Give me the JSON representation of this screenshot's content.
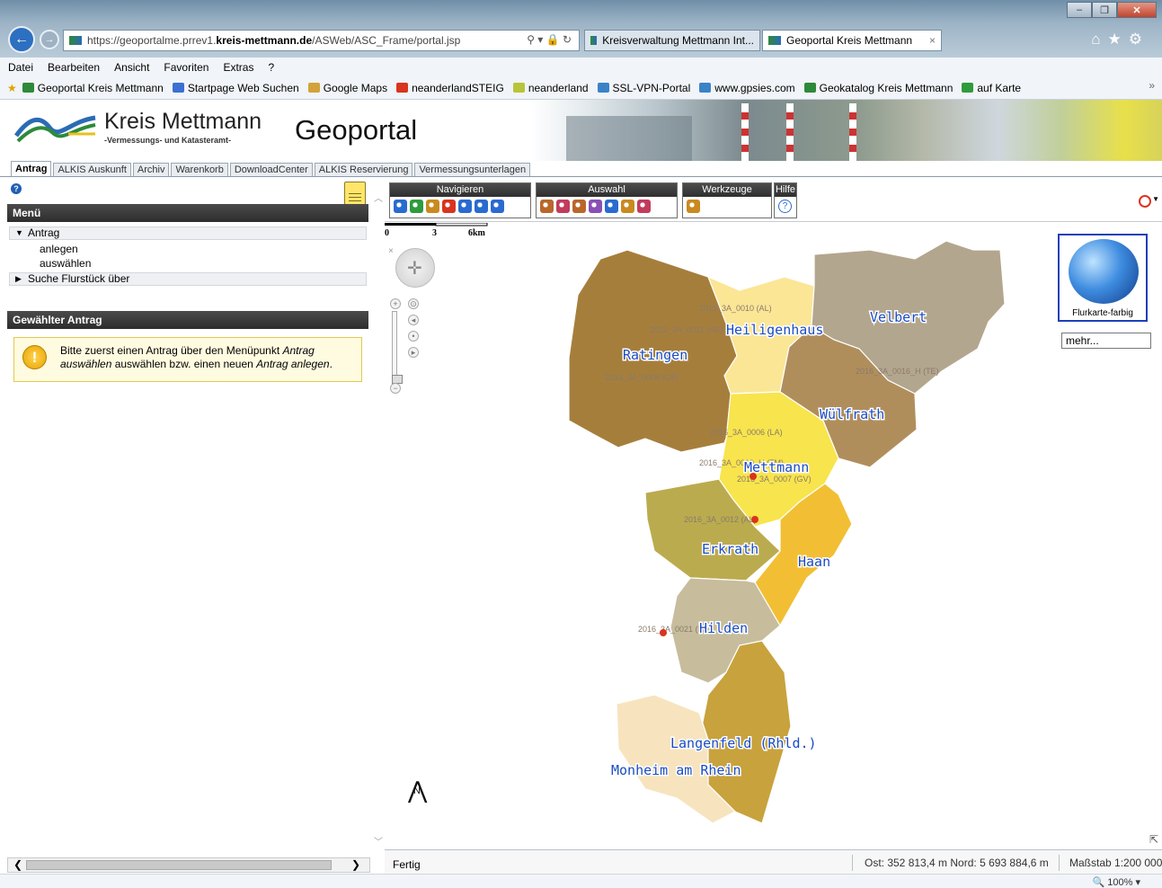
{
  "browser": {
    "url_prefix": "https://geoportalme.prrev1.",
    "url_domain": "kreis-mettmann.de",
    "url_path": "/ASWeb/ASC_Frame/portal.jsp",
    "addr_tools": "⚲ ▾ 🔒 ↻",
    "tabs": [
      {
        "label": "Kreisverwaltung Mettmann Int..."
      },
      {
        "label": "Geoportal Kreis Mettmann",
        "close": "×"
      }
    ],
    "menu": [
      "Datei",
      "Bearbeiten",
      "Ansicht",
      "Favoriten",
      "Extras",
      "?"
    ],
    "favorites": [
      {
        "label": "Geoportal Kreis Mettmann",
        "color": "#2d8a3a"
      },
      {
        "label": "Startpage Web Suchen",
        "color": "#3b6fd1"
      },
      {
        "label": "Google Maps",
        "color": "#d2a33b"
      },
      {
        "label": "neanderlandSTEIG",
        "color": "#d9341f"
      },
      {
        "label": "neanderland",
        "color": "#b8c43a"
      },
      {
        "label": "SSL-VPN-Portal",
        "color": "#3a83c7"
      },
      {
        "label": "www.gpsies.com",
        "color": "#3a83c7"
      },
      {
        "label": "Geokatalog Kreis Mettmann",
        "color": "#2d8a3a"
      },
      {
        "label": "auf Karte",
        "color": "#2f9b3d"
      }
    ],
    "fav_more": "»",
    "zoom": "🔍 100%  ▾"
  },
  "header": {
    "org_name": "Kreis Mettmann",
    "org_sub": "-Vermessungs- und Katasteramt-",
    "title": "Geoportal"
  },
  "app_tabs": [
    "Antrag",
    "ALKIS Auskunft",
    "Archiv",
    "Warenkorb",
    "DownloadCenter",
    "ALKIS Reservierung",
    "Vermessungsunterlagen"
  ],
  "left": {
    "help": "?",
    "menu_title": "Menü",
    "antrag": "Antrag",
    "anlegen": "anlegen",
    "auswaehlen": "auswählen",
    "suche": "Suche Flurstück über",
    "selected_title": "Gewählter Antrag",
    "info_icon": "!",
    "info_a": "Bitte zuerst einen Antrag über den Menüpunkt ",
    "info_b": "Antrag auswählen",
    "info_c": " auswählen bzw. einen neuen ",
    "info_d": "Antrag anlegen",
    "info_e": "."
  },
  "toolbar": {
    "navigate": "Navigieren",
    "selection": "Auswahl",
    "tools": "Werkzeuge",
    "help": "Hilfe",
    "help_icon": "?",
    "nav_icon_colors": [
      "#2a6bd0",
      "#2f9b3d",
      "#c98a1f",
      "#d9341f",
      "#2a6bd0",
      "#2a6bd0",
      "#2a6bd0"
    ],
    "sel_icon_colors": [
      "#b9672a",
      "#c23c5c",
      "#b9672a",
      "#8a4fb5",
      "#2a6bd0",
      "#c98a1f",
      "#c23c5c"
    ],
    "tool_icon_colors": [
      "#c98a1f"
    ]
  },
  "map": {
    "regions": [
      {
        "name": "Ratingen",
        "code": "2016_3A_0008 (GE)",
        "color": "#a67e3c"
      },
      {
        "name": "Heiligenhaus",
        "code": "2016_3A_0010 (AL)",
        "code2": "2016_3A_0011 (HE)",
        "color": "#fbe696"
      },
      {
        "name": "Velbert",
        "code": "2016_3A_0016_H (TE)",
        "color": "#b3a68e"
      },
      {
        "name": "Wülfrath",
        "code": "2016_3A_0006 (LA)",
        "color": "#b08e5c"
      },
      {
        "name": "Mettmann",
        "code": "2016_3A_0019_H (TM)",
        "code2": "2016_3A_0007 (GV)",
        "color": "#f8e44c"
      },
      {
        "name": "Erkrath",
        "code": "2016_3A_0012 (AL)",
        "color": "#bbab4f"
      },
      {
        "name": "Haan",
        "color": "#f2bf34"
      },
      {
        "name": "Hilden",
        "code": "2016_3A_0021 (HI)",
        "color": "#c7bd9d"
      },
      {
        "name": "Langenfeld (Rhld.)",
        "color": "#c8a23c"
      },
      {
        "name": "Monheim am Rhein",
        "color": "#f7e4be"
      }
    ],
    "north": "N",
    "scale_labels": [
      "0",
      "3",
      "6km"
    ],
    "overview_label": "Flurkarte-farbig",
    "more": "mehr...",
    "close_x": "×"
  },
  "status": {
    "ready": "Fertig",
    "coords": "Ost: 352 813,4 m  Nord: 5 693 884,6 m",
    "scale": "Maßstab 1:200 000"
  }
}
